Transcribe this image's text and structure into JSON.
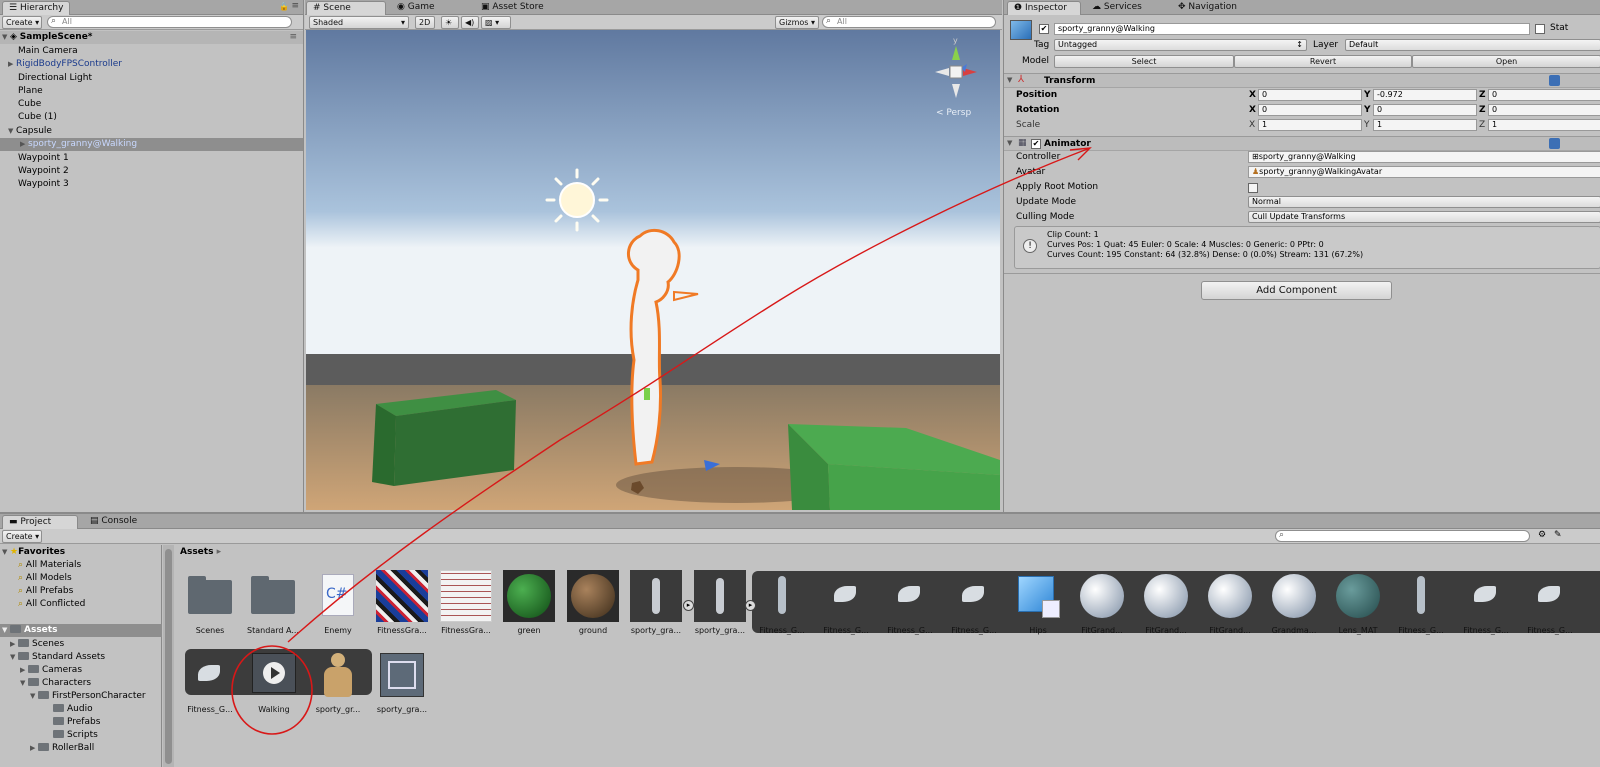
{
  "hierarchy": {
    "tab": "Hierarchy",
    "create": "Create",
    "search_placeholder": "All",
    "scene_name": "SampleScene*",
    "items": [
      {
        "label": "Main Camera"
      },
      {
        "label": "RigidBodyFPSController"
      },
      {
        "label": "Directional Light"
      },
      {
        "label": "Plane"
      },
      {
        "label": "Cube"
      },
      {
        "label": "Cube (1)"
      },
      {
        "label": "Capsule"
      },
      {
        "label": "sporty_granny@Walking"
      },
      {
        "label": "Waypoint 1"
      },
      {
        "label": "Waypoint 2"
      },
      {
        "label": "Waypoint 3"
      }
    ]
  },
  "scene": {
    "tabs": [
      "Scene",
      "Game",
      "Asset Store"
    ],
    "shading": "Shaded",
    "mode_2d": "2D",
    "gizmos": "Gizmos",
    "search_placeholder": "All",
    "persp": "Persp",
    "axis_y": "y"
  },
  "inspector": {
    "tabs": [
      "Inspector",
      "Services",
      "Navigation"
    ],
    "object_name": "sporty_granny@Walking",
    "static_label": "Stat",
    "tag_label": "Tag",
    "tag_value": "Untagged",
    "layer_label": "Layer",
    "layer_value": "Default",
    "model_label": "Model",
    "model_buttons": [
      "Select",
      "Revert",
      "Open"
    ],
    "transform": {
      "title": "Transform",
      "position_label": "Position",
      "rotation_label": "Rotation",
      "scale_label": "Scale",
      "position": [
        "0",
        "-0.972",
        "0"
      ],
      "rotation": [
        "0",
        "0",
        "0"
      ],
      "scale": [
        "1",
        "1",
        "1"
      ],
      "axes": [
        "X",
        "Y",
        "Z"
      ]
    },
    "animator": {
      "title": "Animator",
      "controller_label": "Controller",
      "controller_value": "sporty_granny@Walking",
      "avatar_label": "Avatar",
      "avatar_value": "sporty_granny@WalkingAvatar",
      "root_motion_label": "Apply Root Motion",
      "update_mode_label": "Update Mode",
      "update_mode_value": "Normal",
      "culling_label": "Culling Mode",
      "culling_value": "Cull Update Transforms",
      "info_line1": "Clip Count: 1",
      "info_line2": "Curves Pos: 1 Quat: 45 Euler: 0 Scale: 4 Muscles: 0 Generic: 0 PPtr: 0",
      "info_line3": "Curves Count: 195 Constant: 64 (32.8%) Dense: 0 (0.0%) Stream: 131 (67.2%)"
    },
    "add_component": "Add Component"
  },
  "project": {
    "tabs": [
      "Project",
      "Console"
    ],
    "create": "Create",
    "breadcrumb": "Assets",
    "favorites": {
      "title": "Favorites",
      "items": [
        "All Materials",
        "All Models",
        "All Prefabs",
        "All Conflicted"
      ]
    },
    "tree_root": "Assets",
    "tree": [
      {
        "label": "Scenes"
      },
      {
        "label": "Standard Assets"
      },
      {
        "label": "Cameras"
      },
      {
        "label": "Characters"
      },
      {
        "label": "FirstPersonCharacter"
      },
      {
        "label": "Audio"
      },
      {
        "label": "Prefabs"
      },
      {
        "label": "Scripts"
      },
      {
        "label": "RollerBall"
      }
    ],
    "row1": [
      "Scenes",
      "Standard A...",
      "Enemy",
      "FitnessGra...",
      "FitnessGra...",
      "green",
      "ground",
      "sporty_gra...",
      "sporty_gra...",
      "Fitness_G...",
      "Fitness_G...",
      "Fitness_G...",
      "Fitness_G...",
      "Hips",
      "FitGrand...",
      "FitGrand...",
      "FitGrand...",
      "Grandma...",
      "Lens_MAT",
      "Fitness_G...",
      "Fitness_G...",
      "Fitness_G..."
    ],
    "row2": [
      "Fitness_G...",
      "Walking",
      "sporty_gr...",
      "sporty_gra..."
    ],
    "script_glyph": "C#"
  }
}
